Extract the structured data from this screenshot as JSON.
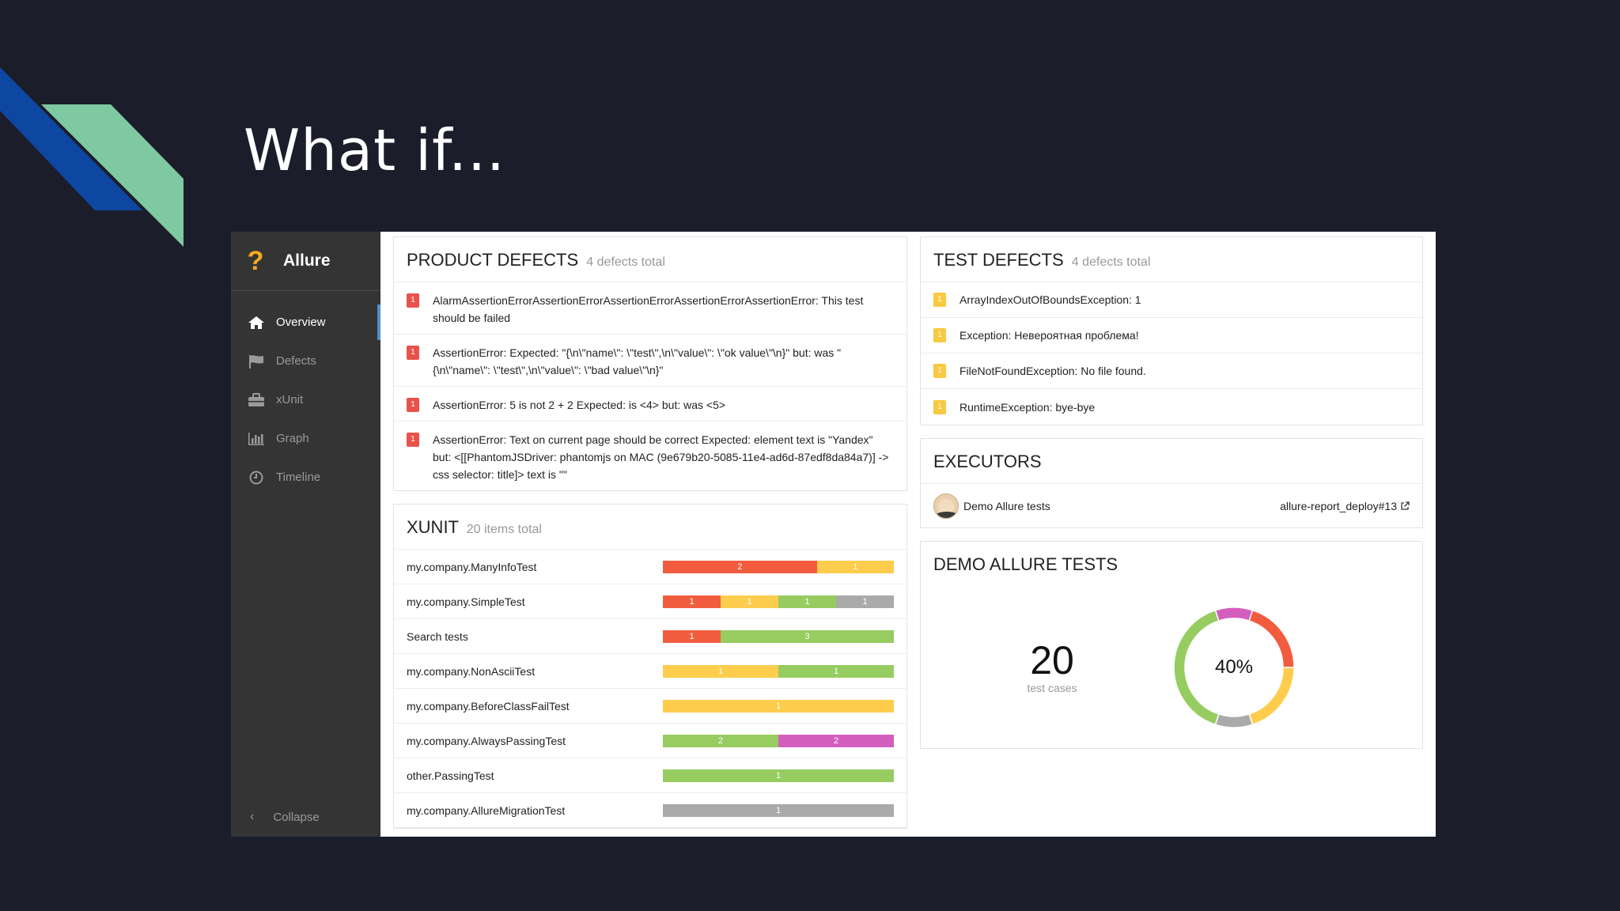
{
  "slide": {
    "title": "What if..."
  },
  "app": {
    "brand": "Allure",
    "brand_icon": "question-mark-icon",
    "nav": [
      {
        "label": "Overview",
        "icon": "home-icon",
        "active": true
      },
      {
        "label": "Defects",
        "icon": "flag-icon",
        "active": false
      },
      {
        "label": "xUnit",
        "icon": "briefcase-icon",
        "active": false
      },
      {
        "label": "Graph",
        "icon": "bar-chart-icon",
        "active": false
      },
      {
        "label": "Timeline",
        "icon": "clock-icon",
        "active": false
      }
    ],
    "collapse_label": "Collapse"
  },
  "product_defects": {
    "title": "PRODUCT DEFECTS",
    "subtitle": "4 defects total",
    "items": [
      {
        "count": "1",
        "text": "AlarmAssertionErrorAssertionErrorAssertionErrorAssertionErrorAssertionError: This test should be failed"
      },
      {
        "count": "1",
        "text": "AssertionError: Expected: \"{\\n\\\"name\\\": \\\"test\\\",\\n\\\"value\\\": \\\"ok value\\\"\\n}\" but: was \"{\\n\\\"name\\\": \\\"test\\\",\\n\\\"value\\\": \\\"bad value\\\"\\n}\""
      },
      {
        "count": "1",
        "text": "AssertionError: 5 is not 2 + 2 Expected: is <4> but: was <5>"
      },
      {
        "count": "1",
        "text": "AssertionError: Text on current page should be correct Expected: element text is \"Yandex\" but: <[[PhantomJSDriver: phantomjs on MAC (9e679b20-5085-11e4-ad6d-87edf8da84a7)] -> css selector: title]> text is \"\""
      }
    ]
  },
  "xunit": {
    "title": "XUNIT",
    "subtitle": "20 items total",
    "rows": [
      {
        "name": "my.company.ManyInfoTest",
        "segments": [
          {
            "status": "red",
            "value": 2
          },
          {
            "status": "yellow",
            "value": 1
          }
        ]
      },
      {
        "name": "my.company.SimpleTest",
        "segments": [
          {
            "status": "red",
            "value": 1
          },
          {
            "status": "yellow",
            "value": 1
          },
          {
            "status": "green",
            "value": 1
          },
          {
            "status": "gray",
            "value": 1
          }
        ]
      },
      {
        "name": "Search tests",
        "segments": [
          {
            "status": "red",
            "value": 1
          },
          {
            "status": "green",
            "value": 3
          }
        ]
      },
      {
        "name": "my.company.NonAsciiTest",
        "segments": [
          {
            "status": "yellow",
            "value": 1
          },
          {
            "status": "green",
            "value": 1
          }
        ]
      },
      {
        "name": "my.company.BeforeClassFailTest",
        "segments": [
          {
            "status": "yellow",
            "value": 1
          }
        ]
      },
      {
        "name": "my.company.AlwaysPassingTest",
        "segments": [
          {
            "status": "green",
            "value": 2
          },
          {
            "status": "pink",
            "value": 2
          }
        ]
      },
      {
        "name": "other.PassingTest",
        "segments": [
          {
            "status": "green",
            "value": 1
          }
        ]
      },
      {
        "name": "my.company.AllureMigrationTest",
        "segments": [
          {
            "status": "gray",
            "value": 1
          }
        ]
      }
    ]
  },
  "test_defects": {
    "title": "TEST DEFECTS",
    "subtitle": "4 defects total",
    "items": [
      {
        "count": "1",
        "text": "ArrayIndexOutOfBoundsException: 1"
      },
      {
        "count": "1",
        "text": "Exception: Невероятная проблема!"
      },
      {
        "count": "1",
        "text": "FileNotFoundException: No file found."
      },
      {
        "count": "1",
        "text": "RuntimeException: bye-bye"
      }
    ]
  },
  "executors": {
    "title": "EXECUTORS",
    "name": "Demo Allure tests",
    "link": "allure-report_deploy#13",
    "avatar_icon": "jenkins-avatar-icon",
    "link_icon": "external-link-icon"
  },
  "demo": {
    "title": "DEMO ALLURE TESTS",
    "total": "20",
    "total_label": "test cases",
    "percent": "40%",
    "donut": [
      {
        "status": "green",
        "value": 8,
        "color": "#96cc60"
      },
      {
        "status": "pink",
        "value": 2,
        "color": "#d35ebe"
      },
      {
        "status": "red",
        "value": 4,
        "color": "#f25c3e"
      },
      {
        "status": "yellow",
        "value": 4,
        "color": "#fecd4d"
      },
      {
        "status": "gray",
        "value": 2,
        "color": "#aaaaaa"
      }
    ]
  },
  "colors": {
    "background": "#1c1d2b",
    "accent_blue": "#0d47a1",
    "accent_green": "#7ec8a2",
    "sidebar": "#343434",
    "red": "#f25c3e",
    "yellow": "#fecd4d",
    "green": "#96cc60",
    "gray": "#aaaaaa",
    "pink": "#d35ebe"
  }
}
